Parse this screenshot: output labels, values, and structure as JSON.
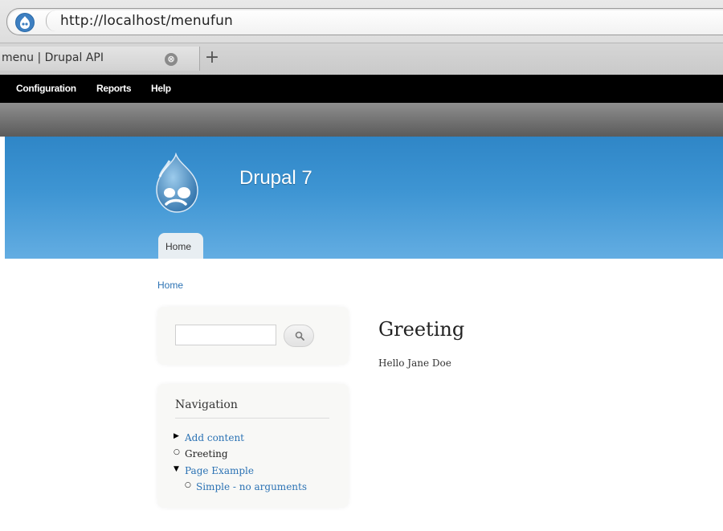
{
  "browser": {
    "url": "http://localhost/menufun",
    "tab_title": "menu | Drupal API",
    "tab_close_glyph": "⊗",
    "new_tab_glyph": "+"
  },
  "admin_toolbar": {
    "items": [
      "Configuration",
      "Reports",
      "Help"
    ]
  },
  "header": {
    "site_name": "Drupal 7",
    "main_tab": "Home"
  },
  "breadcrumb": "Home",
  "search": {
    "placeholder": "",
    "button_icon": "search-icon"
  },
  "navigation": {
    "title": "Navigation",
    "items": [
      {
        "label": "Add content",
        "marker": "collapsed-arrow",
        "link": true
      },
      {
        "label": "Greeting",
        "marker": "leaf-circle",
        "link": false
      },
      {
        "label": "Page Example",
        "marker": "expanded-arrow",
        "link": true
      },
      {
        "label": "Simple - no arguments",
        "marker": "leaf-circle",
        "link": true
      }
    ]
  },
  "content": {
    "title": "Greeting",
    "body": "Hello Jane Doe"
  },
  "colors": {
    "toolbar": "#000000",
    "header_blue": "#3e95d3",
    "link": "#2b72b4"
  }
}
